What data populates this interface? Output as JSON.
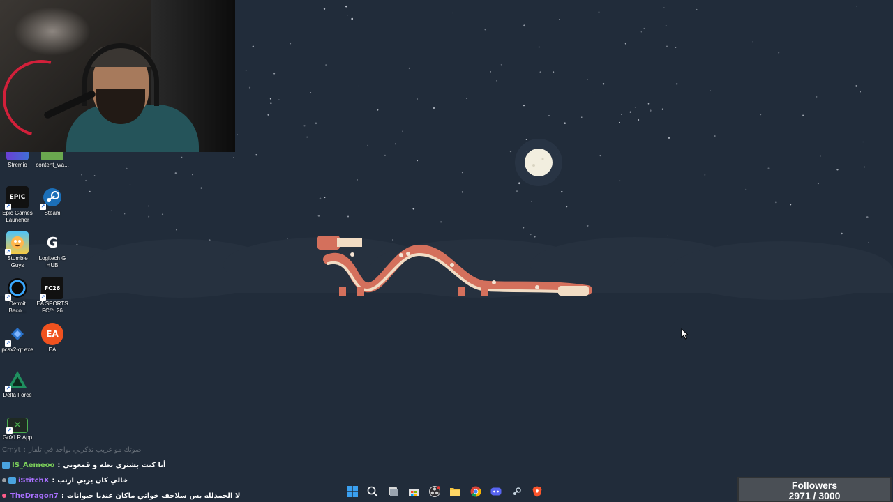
{
  "wallpaper": {
    "background_color": "#212c3a",
    "moon_color": "#f2eedf",
    "dragon_color": "#d4705c",
    "dragon_belly_color": "#f1dcc4"
  },
  "webcam": {
    "icon": "webcam-feed"
  },
  "desktop": {
    "icons": [
      {
        "label": "Stremio",
        "icon": "stremio-icon"
      },
      {
        "label": "content_wa...",
        "icon": "image-file-icon"
      },
      {
        "label": "Epic Games Launcher",
        "icon": "epic-games-icon",
        "tile_text": "EPIC"
      },
      {
        "label": "Steam",
        "icon": "steam-icon"
      },
      {
        "label": "Stumble Guys",
        "icon": "stumble-guys-icon"
      },
      {
        "label": "Logitech G HUB",
        "icon": "logitech-g-icon",
        "tile_text": "G"
      },
      {
        "label": "Detroit Beco...",
        "icon": "detroit-icon"
      },
      {
        "label": "EA SPORTS FC™ 26",
        "icon": "ea-sports-fc-icon",
        "tile_text": "FC26"
      },
      {
        "label": "pcsx2-qt.exe",
        "icon": "pcsx2-icon"
      },
      {
        "label": "EA",
        "icon": "ea-icon",
        "tile_text": "EA"
      },
      {
        "label": "Delta Force",
        "icon": "delta-force-icon"
      },
      {
        "label": "GoXLR App",
        "icon": "goxlr-icon",
        "tile_text": "✕"
      }
    ]
  },
  "chat": {
    "messages": [
      {
        "user": "Cmyt",
        "sep": " :",
        "text": "صوتك مو غريب تذكرني بواحد في تلفاز",
        "user_color": "#9aa0a6",
        "faded": true
      },
      {
        "user": "IS_Aemeoo",
        "sep": " :",
        "text": "أنا كنت بشتري بطة و قمعوني",
        "user_color": "#7cd05a",
        "badge_color": "#4aa3df"
      },
      {
        "user": "iStitchX",
        "sep": " :",
        "text": "خالي كان يربي ارنب",
        "user_color": "#a970ff",
        "badge_color": "#4aa3df"
      },
      {
        "user": "TheDragon7",
        "sep": " :",
        "text": "لا الحمدلله بس سلاحف خواتي ماكان عندنا حيوانات",
        "user_color": "#a970ff"
      }
    ]
  },
  "taskbar": {
    "items": [
      {
        "icon": "windows-start-icon",
        "color": "#3aa0f0"
      },
      {
        "icon": "search-icon",
        "color": "#ffffff"
      },
      {
        "icon": "task-view-icon",
        "color": "#d8d8d8"
      },
      {
        "icon": "microsoft-store-icon",
        "color": "#e0e0e0"
      },
      {
        "icon": "obs-studio-icon",
        "color": "#d0d0d0"
      },
      {
        "icon": "file-explorer-icon",
        "color": "#f5c542"
      },
      {
        "icon": "chrome-icon",
        "color": "#4caf50"
      },
      {
        "icon": "discord-icon",
        "color": "#5865f2"
      },
      {
        "icon": "steam-icon",
        "color": "#c7d5e0"
      },
      {
        "icon": "brave-icon",
        "color": "#fb542b"
      }
    ]
  },
  "followers": {
    "title": "Followers",
    "current": "2971",
    "separator": " / ",
    "goal": "3000",
    "progress": 0.99
  }
}
